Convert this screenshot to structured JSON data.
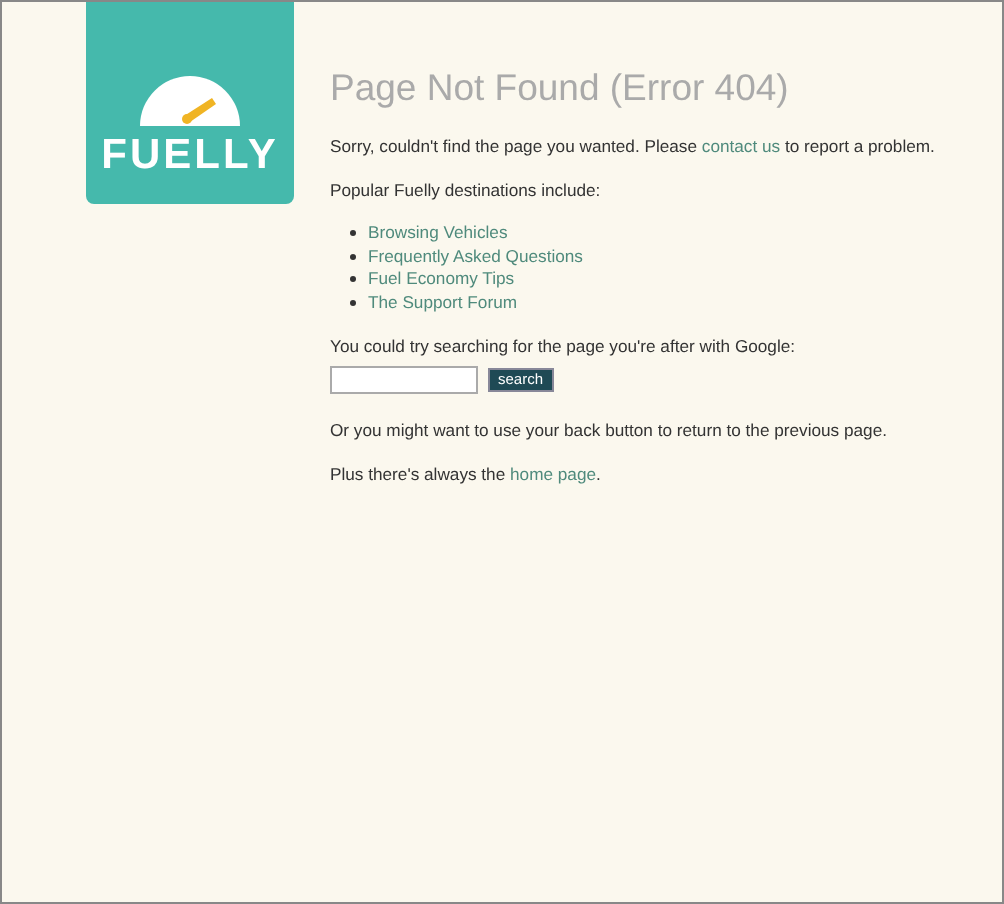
{
  "logo": {
    "text": "FUELLY"
  },
  "title": "Page Not Found (Error 404)",
  "intro": {
    "before": "Sorry, couldn't find the page you wanted. Please ",
    "link": "contact us",
    "after": " to report a problem."
  },
  "destinations_heading": "Popular Fuelly destinations include:",
  "destinations": [
    "Browsing Vehicles",
    "Frequently Asked Questions",
    "Fuel Economy Tips",
    "The Support Forum"
  ],
  "search_prompt": "You could try searching for the page you're after with Google:",
  "search": {
    "button": "search"
  },
  "back_note": "Or you might want to use your back button to return to the previous page.",
  "home": {
    "before": "Plus there's always the ",
    "link": "home page",
    "after": "."
  }
}
